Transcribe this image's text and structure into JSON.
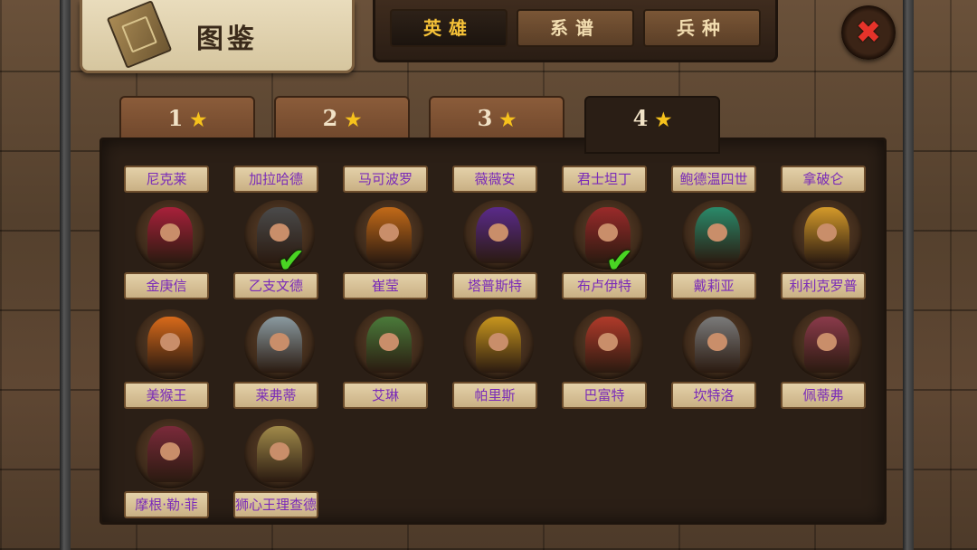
{
  "title": "图鉴",
  "top_tabs": [
    {
      "label": "英雄",
      "active": true
    },
    {
      "label": "系谱",
      "active": false
    },
    {
      "label": "兵种",
      "active": false
    }
  ],
  "close_icon": "close-x-icon",
  "star_tabs": [
    {
      "label": "1",
      "active": false
    },
    {
      "label": "2",
      "active": false
    },
    {
      "label": "3",
      "active": false
    },
    {
      "label": "4",
      "active": true
    }
  ],
  "star_glyph": "★",
  "heroes_row0": [
    "尼克莱",
    "加拉哈德",
    "马可波罗",
    "薇薇安",
    "君士坦丁",
    "鲍德温四世",
    "拿破仑"
  ],
  "heroes": [
    {
      "name": "金庚信",
      "owned": false,
      "color": "#a8203a"
    },
    {
      "name": "乙支文德",
      "owned": true,
      "color": "#4a4a4a"
    },
    {
      "name": "崔莹",
      "owned": false,
      "color": "#c26a18"
    },
    {
      "name": "塔普斯特",
      "owned": false,
      "color": "#5a2a8a"
    },
    {
      "name": "布卢伊特",
      "owned": true,
      "color": "#9a2a2a"
    },
    {
      "name": "戴莉亚",
      "owned": false,
      "color": "#2a8a6a"
    },
    {
      "name": "利利克罗普",
      "owned": false,
      "color": "#d49a2a"
    },
    {
      "name": "美猴王",
      "owned": false,
      "color": "#d86a1a"
    },
    {
      "name": "莱弗蒂",
      "owned": false,
      "color": "#8a9aa0"
    },
    {
      "name": "艾琳",
      "owned": false,
      "color": "#4a7a3a"
    },
    {
      "name": "帕里斯",
      "owned": false,
      "color": "#c8961e"
    },
    {
      "name": "巴富特",
      "owned": false,
      "color": "#b03a2a"
    },
    {
      "name": "坎特洛",
      "owned": false,
      "color": "#7a7a7a"
    },
    {
      "name": "佩蒂弗",
      "owned": false,
      "color": "#8a3a4a"
    },
    {
      "name": "摩根·勒·菲",
      "owned": false,
      "color": "#7a2a3a"
    },
    {
      "name": "狮心王理查德",
      "owned": false,
      "color": "#a08a4a"
    }
  ],
  "check_glyph": "✔"
}
